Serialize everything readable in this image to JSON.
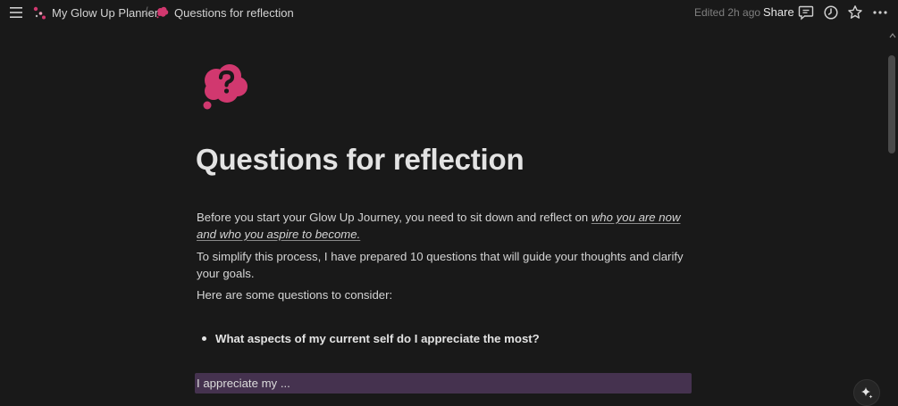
{
  "topbar": {
    "breadcrumb": [
      {
        "label": "My Glow Up Planner",
        "icon": "planner-logo-icon"
      },
      {
        "label": "Questions for reflection",
        "icon": "question-cloud-icon"
      }
    ],
    "separator": "/",
    "edited": "Edited 2h ago",
    "share_label": "Share"
  },
  "page": {
    "icon": "question-cloud-icon",
    "icon_color": "#d1386f",
    "title": "Questions for reflection",
    "intro_before": "Before you start your Glow Up Journey, you need to sit down and reflect on ",
    "intro_emphasis": "who you are now and who you aspire to become.",
    "para2": "To simplify this process, I have prepared 10 questions that will guide your thoughts and clarify your goals.",
    "para3": "Here are some questions to consider:",
    "question1": "What aspects of my current self do I appreciate the most?",
    "answer1": "I appreciate my ..."
  },
  "colors": {
    "background": "#191919",
    "answer_highlight": "#45324f",
    "accent_pink": "#d1386f"
  }
}
